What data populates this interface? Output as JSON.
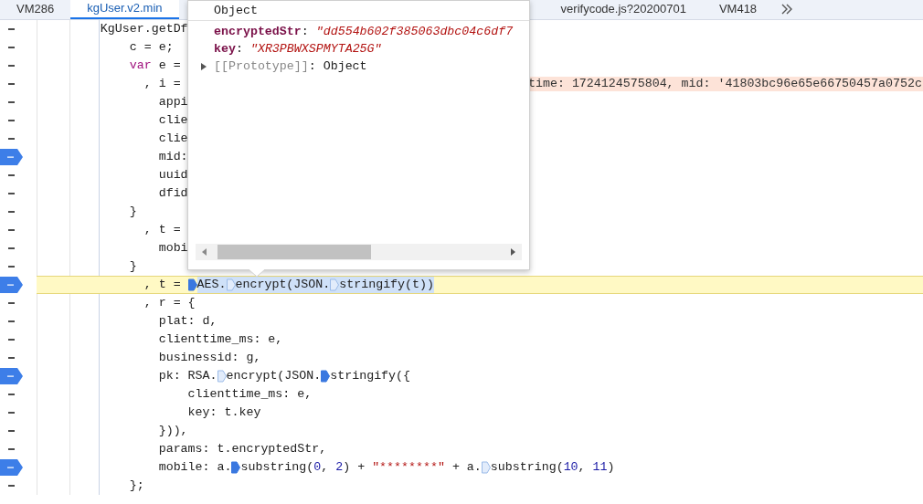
{
  "tabs": [
    {
      "label": "VM286",
      "selected": false
    },
    {
      "label": "kgUser.v2.min",
      "selected": true
    },
    {
      "label": "verifycode.js?20200701",
      "selected": false
    },
    {
      "label": "VM418",
      "selected": false
    }
  ],
  "code_lines": [
    {
      "breakpoint": false,
      "current": false,
      "segments": [
        {
          "kind": "plain",
          "text": "        KgUser.getDf"
        }
      ]
    },
    {
      "breakpoint": false,
      "current": false,
      "segments": [
        {
          "kind": "plain",
          "text": "            c = e;"
        }
      ]
    },
    {
      "breakpoint": false,
      "current": false,
      "segments": [
        {
          "kind": "keyword",
          "text": "            var"
        },
        {
          "kind": "plain",
          "text": " e ="
        }
      ]
    },
    {
      "breakpoint": false,
      "current": false,
      "segments": [
        {
          "kind": "plain",
          "text": "              , i ="
        }
      ],
      "inline_value": "time: 1724124575804, mid: '41803bc96e65e66750457a0752c"
    },
    {
      "breakpoint": false,
      "current": false,
      "segments": [
        {
          "kind": "plain",
          "text": "                appi"
        }
      ]
    },
    {
      "breakpoint": false,
      "current": false,
      "segments": [
        {
          "kind": "plain",
          "text": "                clie"
        }
      ]
    },
    {
      "breakpoint": false,
      "current": false,
      "segments": [
        {
          "kind": "plain",
          "text": "                clie"
        }
      ]
    },
    {
      "breakpoint": true,
      "current": false,
      "segments": [
        {
          "kind": "plain",
          "text": "                mid:"
        }
      ]
    },
    {
      "breakpoint": false,
      "current": false,
      "segments": [
        {
          "kind": "plain",
          "text": "                uuid"
        }
      ]
    },
    {
      "breakpoint": false,
      "current": false,
      "segments": [
        {
          "kind": "plain",
          "text": "                dfid"
        }
      ]
    },
    {
      "breakpoint": false,
      "current": false,
      "segments": [
        {
          "kind": "plain",
          "text": "            }"
        }
      ]
    },
    {
      "breakpoint": false,
      "current": false,
      "segments": [
        {
          "kind": "plain",
          "text": "              , t ="
        }
      ]
    },
    {
      "breakpoint": false,
      "current": false,
      "segments": [
        {
          "kind": "plain",
          "text": "                mobi"
        }
      ]
    },
    {
      "breakpoint": false,
      "current": false,
      "segments": [
        {
          "kind": "plain",
          "text": "            }"
        }
      ]
    },
    {
      "breakpoint": true,
      "current": true,
      "segments": [
        {
          "kind": "plain",
          "text": "              , t = "
        },
        {
          "kind": "mark",
          "active": true
        }
      ],
      "selection": [
        {
          "kind": "plain",
          "text": "AES."
        },
        {
          "kind": "mark",
          "active": false
        },
        {
          "kind": "plain",
          "text": "encrypt(JSON."
        },
        {
          "kind": "mark",
          "active": false
        },
        {
          "kind": "plain",
          "text": "stringify(t))"
        }
      ]
    },
    {
      "breakpoint": false,
      "current": false,
      "segments": [
        {
          "kind": "plain",
          "text": "              , r = {"
        }
      ]
    },
    {
      "breakpoint": false,
      "current": false,
      "segments": [
        {
          "kind": "plain",
          "text": "                plat: d,"
        }
      ]
    },
    {
      "breakpoint": false,
      "current": false,
      "segments": [
        {
          "kind": "plain",
          "text": "                clienttime_ms: e,"
        }
      ]
    },
    {
      "breakpoint": false,
      "current": false,
      "segments": [
        {
          "kind": "plain",
          "text": "                businessid: g,"
        }
      ]
    },
    {
      "breakpoint": true,
      "current": false,
      "segments": [
        {
          "kind": "plain",
          "text": "                pk: RSA."
        },
        {
          "kind": "mark",
          "active": false
        },
        {
          "kind": "plain",
          "text": "encrypt(JSON."
        },
        {
          "kind": "mark",
          "active": true
        },
        {
          "kind": "plain",
          "text": "stringify({"
        }
      ]
    },
    {
      "breakpoint": false,
      "current": false,
      "segments": [
        {
          "kind": "plain",
          "text": "                    clienttime_ms: e,"
        }
      ]
    },
    {
      "breakpoint": false,
      "current": false,
      "segments": [
        {
          "kind": "plain",
          "text": "                    key: t.key"
        }
      ]
    },
    {
      "breakpoint": false,
      "current": false,
      "segments": [
        {
          "kind": "plain",
          "text": "                })),"
        }
      ]
    },
    {
      "breakpoint": false,
      "current": false,
      "segments": [
        {
          "kind": "plain",
          "text": "                params: t.encryptedStr,"
        }
      ]
    },
    {
      "breakpoint": true,
      "current": false,
      "segments": [
        {
          "kind": "plain",
          "text": "                mobile: a."
        },
        {
          "kind": "mark",
          "active": true
        },
        {
          "kind": "plain",
          "text": "substring("
        },
        {
          "kind": "number",
          "text": "0"
        },
        {
          "kind": "plain",
          "text": ", "
        },
        {
          "kind": "number",
          "text": "2"
        },
        {
          "kind": "plain",
          "text": ") + "
        },
        {
          "kind": "string",
          "text": "\"********\""
        },
        {
          "kind": "plain",
          "text": " + a."
        },
        {
          "kind": "mark",
          "active": false
        },
        {
          "kind": "plain",
          "text": "substring("
        },
        {
          "kind": "number",
          "text": "10"
        },
        {
          "kind": "plain",
          "text": ", "
        },
        {
          "kind": "number",
          "text": "11"
        },
        {
          "kind": "plain",
          "text": ")"
        }
      ]
    },
    {
      "breakpoint": false,
      "current": false,
      "segments": [
        {
          "kind": "plain",
          "text": "            };"
        }
      ]
    }
  ],
  "popover": {
    "title": "Object",
    "properties": [
      {
        "name": "encryptedStr",
        "colon": ":",
        "value": "\"dd554b602f385063dbc04c6df7"
      },
      {
        "name": "key",
        "colon": ":",
        "value": "\"XR3PBWXSPMYTA25G\""
      }
    ],
    "prototype": {
      "name": "[[Prototype]]",
      "colon": ":",
      "value": "Object",
      "expanded": false
    }
  }
}
